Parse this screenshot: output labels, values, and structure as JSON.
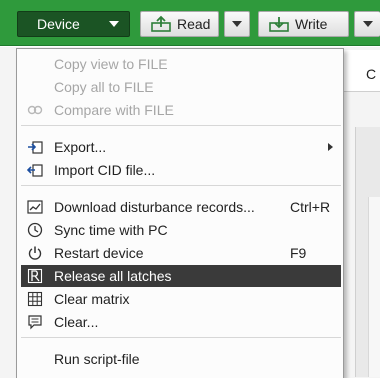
{
  "toolbar": {
    "device_label": "Device",
    "read_label": "Read",
    "write_label": "Write",
    "accent_color": "#2f9a3c",
    "device_button_color": "#1b5424"
  },
  "background": {
    "tab_label": "C"
  },
  "menu": {
    "items": [
      {
        "label": "Copy view to FILE",
        "icon": "",
        "enabled": false
      },
      {
        "label": "Copy all to FILE",
        "icon": "",
        "enabled": false
      },
      {
        "label": "Compare with FILE",
        "icon": "compare-icon",
        "enabled": false
      },
      {
        "label": "Export...",
        "icon": "export-icon",
        "enabled": true,
        "submenu": true
      },
      {
        "label": "Import CID file...",
        "icon": "import-icon",
        "enabled": true
      },
      {
        "label": "Download disturbance records...",
        "icon": "disturbance-chart-icon",
        "enabled": true,
        "shortcut": "Ctrl+R"
      },
      {
        "label": "Sync time with PC",
        "icon": "clock-icon",
        "enabled": true
      },
      {
        "label": "Restart device",
        "icon": "power-icon",
        "enabled": true,
        "shortcut": "F9"
      },
      {
        "label": "Release all latches",
        "icon": "release-icon",
        "enabled": true,
        "selected": true
      },
      {
        "label": "Clear matrix",
        "icon": "grid-icon",
        "enabled": true
      },
      {
        "label": "Clear...",
        "icon": "clear-message-icon",
        "enabled": true
      },
      {
        "label": "Run script-file",
        "icon": "",
        "enabled": true
      }
    ]
  }
}
